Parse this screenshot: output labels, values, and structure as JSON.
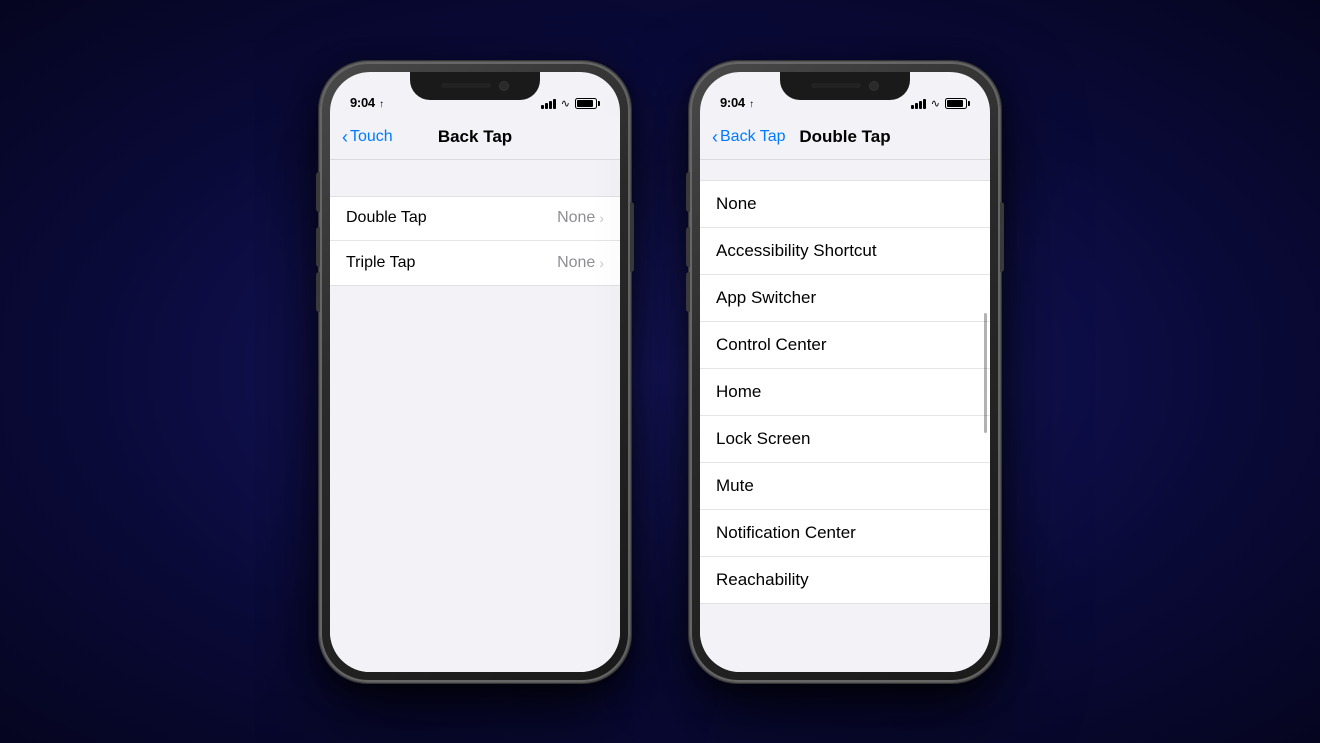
{
  "background": {
    "gradient": "radial dark blue"
  },
  "phone_left": {
    "status_bar": {
      "time": "9:04",
      "location_arrow": "▲"
    },
    "nav": {
      "back_label": "Touch",
      "title": "Back Tap"
    },
    "list_items": [
      {
        "label": "Double Tap",
        "value": "None"
      },
      {
        "label": "Triple Tap",
        "value": "None"
      }
    ]
  },
  "phone_right": {
    "status_bar": {
      "time": "9:04",
      "location_arrow": "▲"
    },
    "nav": {
      "back_label": "Back Tap",
      "title": "Double Tap"
    },
    "list_items": [
      {
        "label": "None"
      },
      {
        "label": "Accessibility Shortcut"
      },
      {
        "label": "App Switcher"
      },
      {
        "label": "Control Center"
      },
      {
        "label": "Home"
      },
      {
        "label": "Lock Screen"
      },
      {
        "label": "Mute"
      },
      {
        "label": "Notification Center"
      },
      {
        "label": "Reachability"
      }
    ]
  }
}
